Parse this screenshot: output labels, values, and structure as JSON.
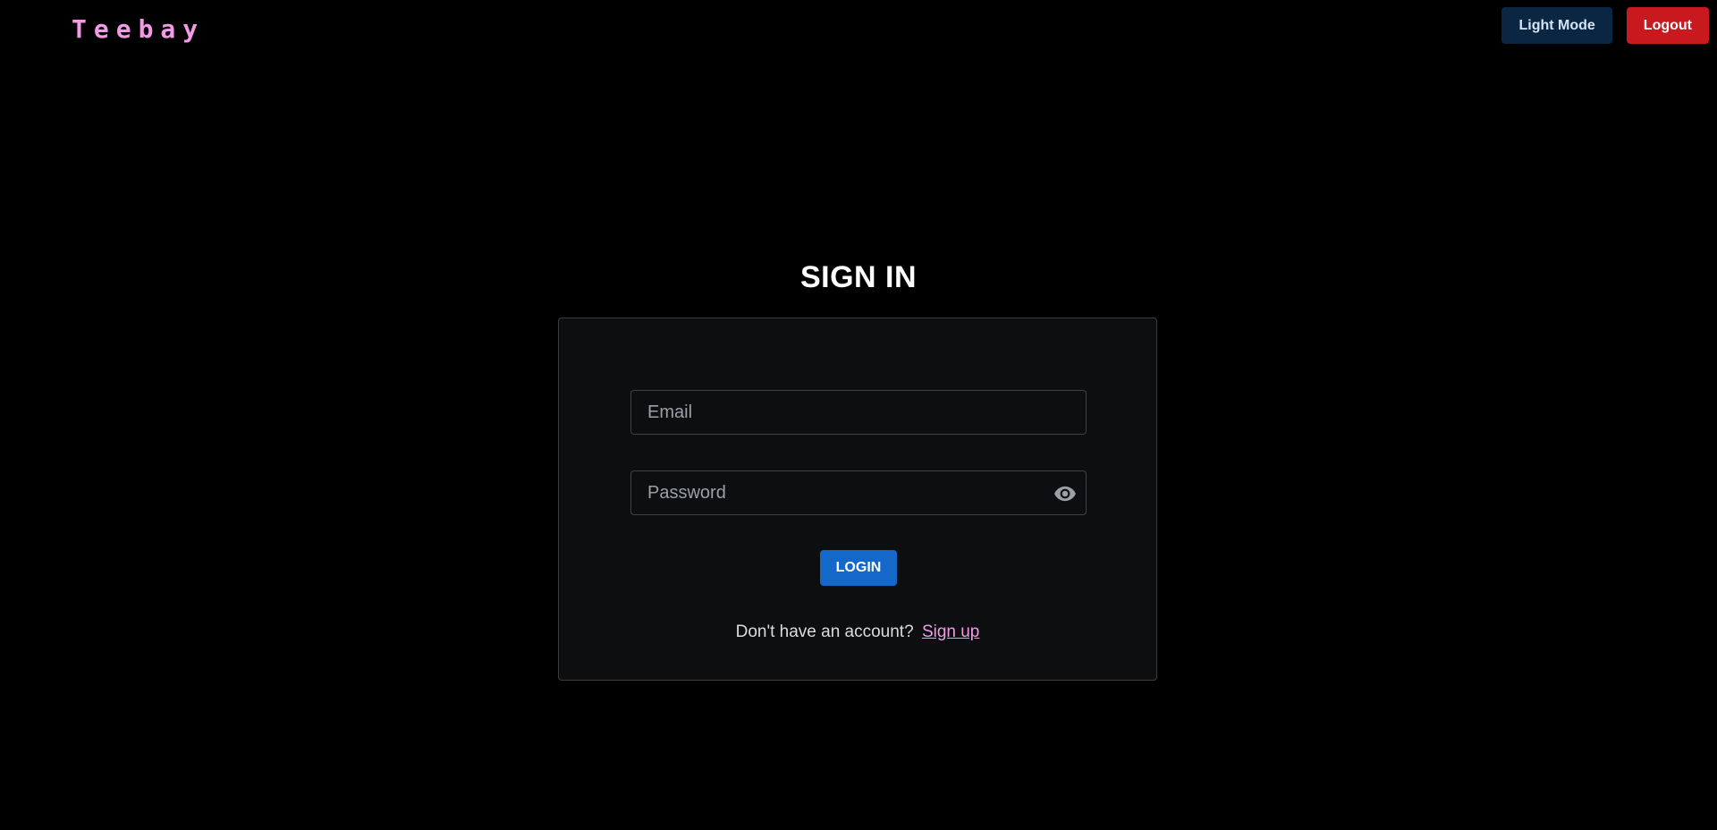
{
  "header": {
    "logo": "Teebay",
    "light_mode_label": "Light Mode",
    "logout_label": "Logout"
  },
  "signin": {
    "title": "SIGN IN",
    "email_placeholder": "Email",
    "email_value": "",
    "password_placeholder": "Password",
    "password_value": "",
    "toggle_icon": "eye-icon",
    "login_label": "LOGIN",
    "no_account_text": "Don't have an account?",
    "signup_link": "Sign up"
  },
  "colors": {
    "background": "#000000",
    "card": "#0d0e10",
    "brand": "#f29ae6",
    "light_mode_button": "#0b2643",
    "logout_button": "#c8191f",
    "login_button": "#1368c9"
  }
}
